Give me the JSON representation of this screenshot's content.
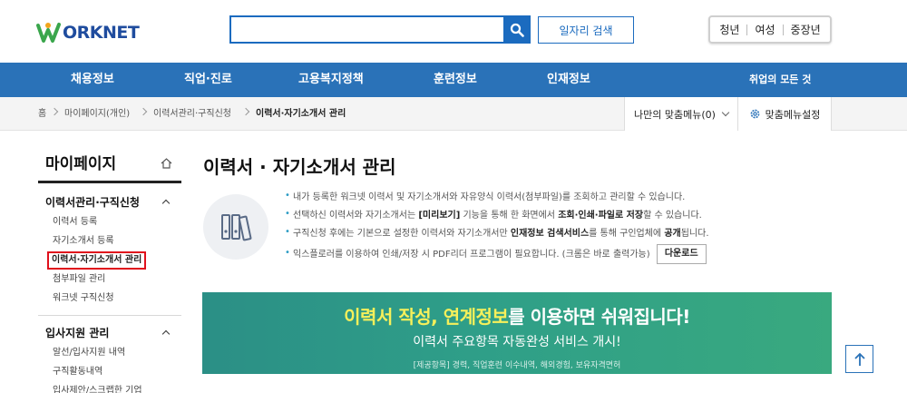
{
  "header": {
    "logo_text": "ORKNET",
    "job_search_label": "일자리 검색",
    "user_types": [
      "청년",
      "여성",
      "중장년"
    ]
  },
  "nav": {
    "items": [
      "채용정보",
      "직업·진로",
      "고용복지정책",
      "훈련정보",
      "인재정보"
    ],
    "all_label": "취업의 모든 것"
  },
  "breadcrumb": {
    "home": "홈",
    "items": [
      "마이페이지(개인)",
      "이력서관리·구직신청",
      "이력서·자기소개서 관리"
    ]
  },
  "mymenu": {
    "label": "나만의 맞춤메뉴(0)",
    "setting_label": "맞춤메뉴설정"
  },
  "sidebar": {
    "title": "마이페이지",
    "groups": [
      {
        "label": "이력서관리·구직신청",
        "items": [
          "이력서 등록",
          "자기소개서 등록",
          "이력서·자기소개서 관리",
          "첨부파일 관리",
          "워크넷 구직신청"
        ]
      },
      {
        "label": "입사지원 관리",
        "items": [
          "알선/입사지원 내역",
          "구직활동내역",
          "입사제안/스크랩한 기업"
        ]
      }
    ]
  },
  "main": {
    "title": "이력서 · 자기소개서 관리",
    "notes": [
      "내가 등록한 워크넷 이력서 및 자기소개서와 자유양식 이력서(첨부파일)를 조회하고 관리할 수 있습니다.",
      "선택하신 이력서와 자기소개서는 [미리보기] 기능을 통해 한 화면에서 조회·인쇄·파일로 저장할 수 있습니다.",
      "구직신청 후에는 기본으로 설정한 이력서와 자기소개서만 인재정보 검색서비스를 통해 구인업체에 공개됩니다.",
      "익스플로러를 이용하여 인쇄/저장 시 PDF리더 프로그램이 필요합니다. (크롬은 바로 출력가능)"
    ],
    "note2_parts": {
      "a": "선택하신 이력서와 자기소개서는 ",
      "b": "[미리보기]",
      "c": " 기능을 통해 한 화면에서 ",
      "d": "조회·인쇄·파일로 저장",
      "e": "할 수 있습니다."
    },
    "note3_parts": {
      "a": "구직신청 후에는 기본으로 설정한 이력서와 자기소개서만 ",
      "b": "인재정보 검색서비스",
      "c": "를 통해 구인업체에 ",
      "d": "공개",
      "e": "됩니다."
    },
    "download_label": "다운로드"
  },
  "banner": {
    "line1_hl1": "이력서 작성, ",
    "line1_hl2": "연계정보",
    "line1_rest": "를 이용하면 쉬워집니다!",
    "line2": "이력서 주요항목 자동완성 서비스 개시!",
    "line3": "[제공항목] 경력, 직업훈련 이수내역, 해외경험, 보유자격면허"
  }
}
